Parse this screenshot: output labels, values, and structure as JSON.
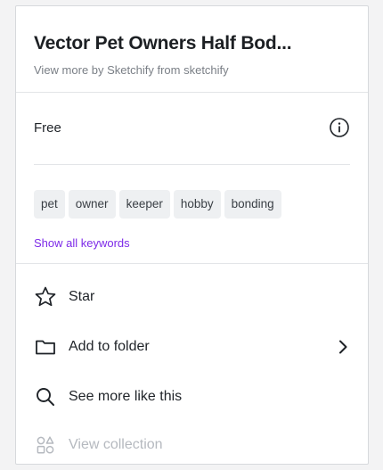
{
  "panel": {
    "title": "Vector Pet Owners Half Bod...",
    "subtitle": "View more by Sketchify from sketchify"
  },
  "license": {
    "label": "Free",
    "info_icon": "info-circle-icon"
  },
  "keywords": {
    "items": [
      "pet",
      "owner",
      "keeper",
      "hobby",
      "bonding"
    ],
    "show_all_label": "Show all keywords"
  },
  "menu": {
    "star": {
      "label": "Star",
      "icon": "star-icon"
    },
    "add_to_folder": {
      "label": "Add to folder",
      "icon": "folder-icon",
      "trailing_icon": "chevron-right-icon"
    },
    "see_more": {
      "label": "See more like this",
      "icon": "search-icon"
    },
    "view_collection": {
      "label": "View collection",
      "icon": "collection-icon",
      "disabled": true
    }
  },
  "colors": {
    "accent": "#7d2ae8",
    "text": "#1f2328",
    "muted": "#7a7f86",
    "disabled": "#b5b9bf",
    "chip_bg": "#eef0f2"
  }
}
